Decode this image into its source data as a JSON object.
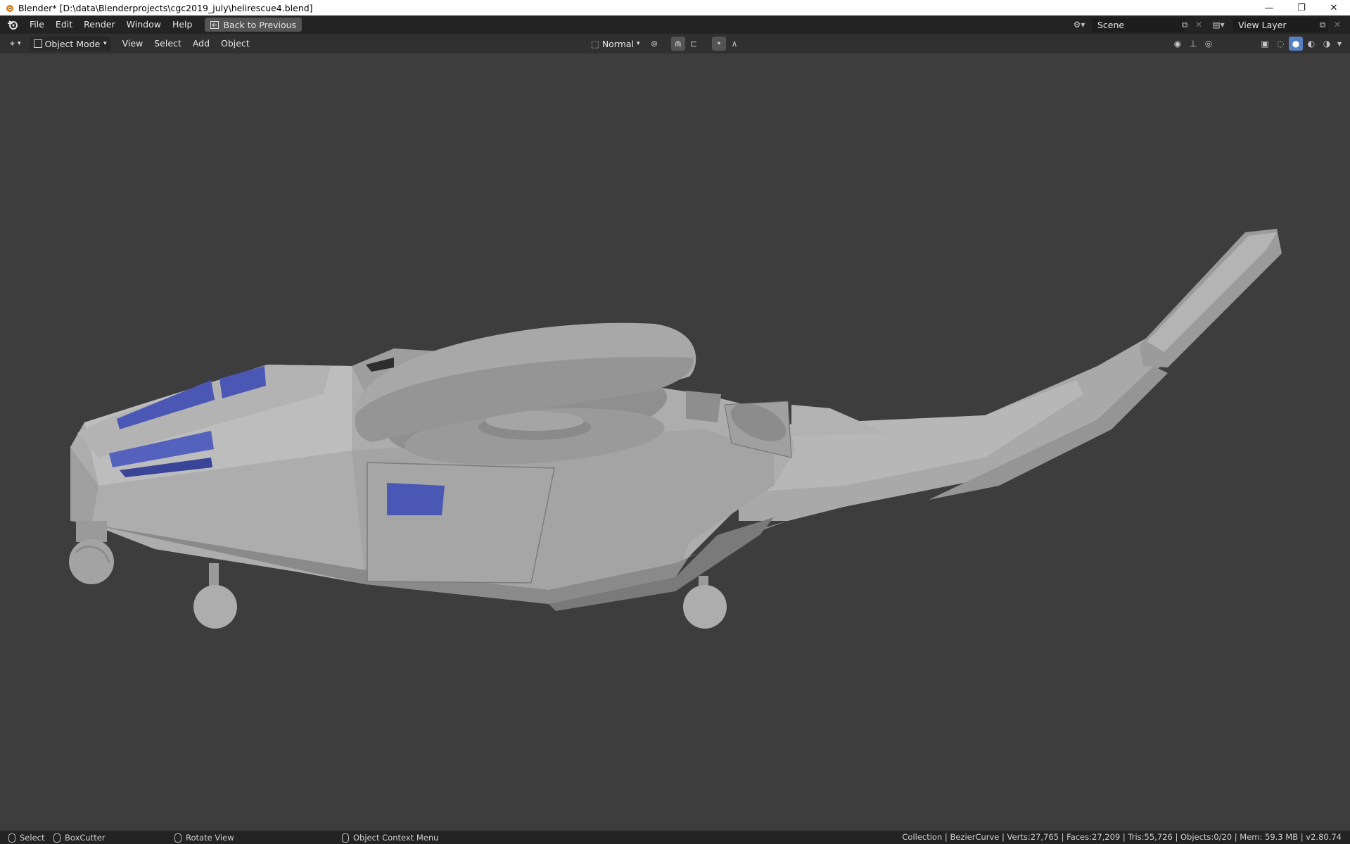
{
  "window": {
    "title": "Blender* [D:\\data\\Blenderprojects\\cgc2019_july\\helirescue4.blend]",
    "minimize": "—",
    "restore": "❐",
    "close": "✕"
  },
  "menubar": {
    "items": [
      "File",
      "Edit",
      "Render",
      "Window",
      "Help"
    ],
    "back_button": "Back to Previous",
    "scene_label": "Scene",
    "view_layer_label": "View Layer"
  },
  "header": {
    "mode": "Object Mode",
    "menus": [
      "View",
      "Select",
      "Add",
      "Object"
    ],
    "orientation": "Normal",
    "shading_active": "solid"
  },
  "statusbar": {
    "left_click": "Select",
    "left_tool": "BoxCutter",
    "middle": "Rotate View",
    "right": "Object Context Menu",
    "stats": "Collection | BezierCurve | Verts:27,765 | Faces:27,209 | Tris:55,726 | Objects:0/20 | Mem: 59.3 MB | v2.80.74"
  },
  "colors": {
    "viewport_bg": "#3d3d3d",
    "model_gray": "#a8a8a8",
    "glass_blue": "#4a57b5",
    "accent": "#5680c2"
  }
}
